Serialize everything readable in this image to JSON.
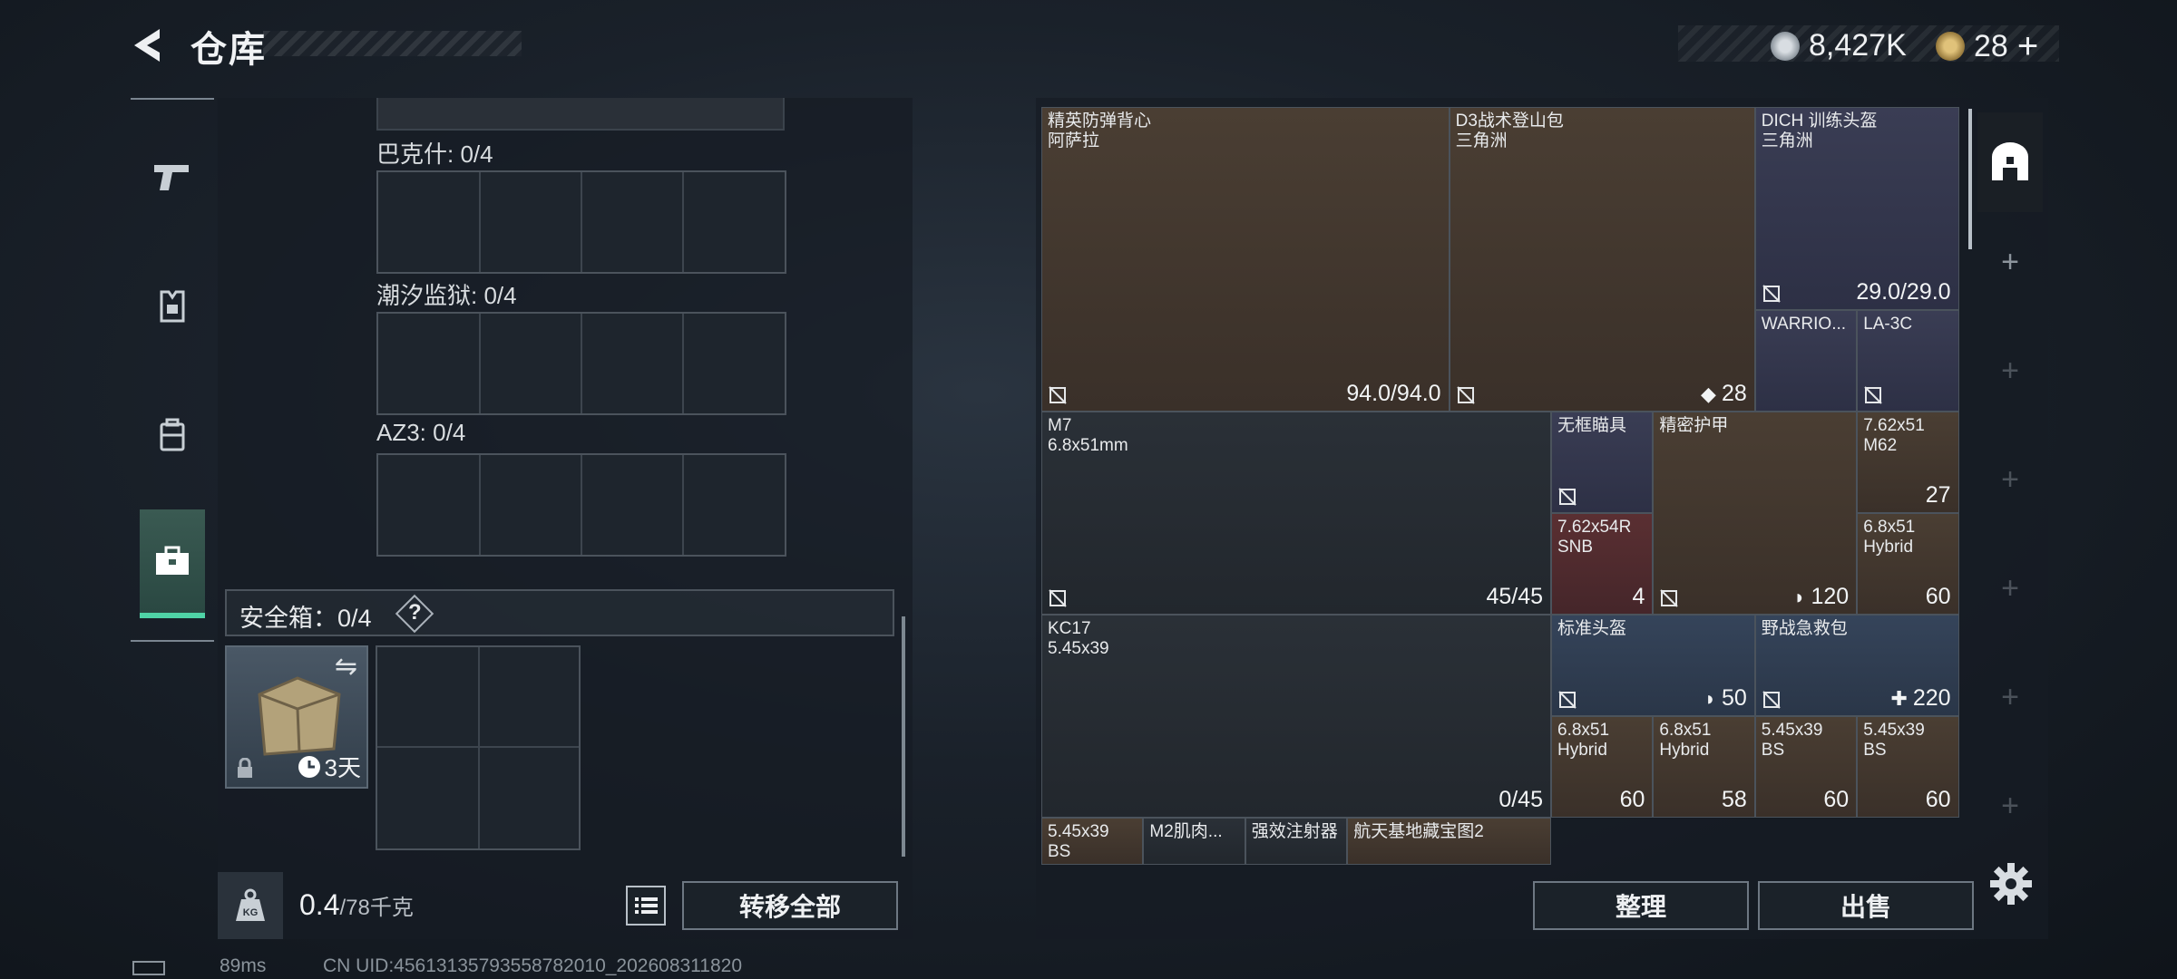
{
  "header": {
    "title": "仓库"
  },
  "currency": {
    "coins": "8,427K",
    "tickets": "28"
  },
  "stash": {
    "groups": [
      {
        "label": "巴克什: 0/4"
      },
      {
        "label": "潮汐监狱: 0/4"
      },
      {
        "label": "AZ3: 0/4"
      }
    ],
    "safe": {
      "label": "安全箱：0/4",
      "help": "?",
      "timer": "3天"
    }
  },
  "bottom": {
    "weight_current": "0.4",
    "weight_max": "/78千克",
    "transfer_label": "转移全部",
    "sort_label": "整理",
    "sell_label": "出售"
  },
  "inventory": [
    {
      "name": "精英防弹背心\n阿萨拉",
      "value": "94.0/94.0"
    },
    {
      "name": "D3战术登山包\n三角洲",
      "value": "28"
    },
    {
      "name": "DICH 训练头盔\n三角洲",
      "value": "29.0/29.0"
    },
    {
      "name": "WARRIO...",
      "value": ""
    },
    {
      "name": "LA-3C",
      "value": ""
    },
    {
      "name": "M7\n6.8x51mm",
      "value": "45/45"
    },
    {
      "name": "无框瞄具",
      "value": ""
    },
    {
      "name": "精密护甲",
      "value": "120"
    },
    {
      "name": "7.62x51\nM62",
      "value": "27"
    },
    {
      "name": "7.62x54R\nSNB",
      "value": "4"
    },
    {
      "name": "6.8x51\nHybrid",
      "value": "60"
    },
    {
      "name": "KC17\n5.45x39",
      "value": "0/45"
    },
    {
      "name": "标准头盔",
      "value": "50"
    },
    {
      "name": "野战急救包",
      "value": "220"
    },
    {
      "name": "6.8x51\nHybrid",
      "value": "60"
    },
    {
      "name": "6.8x51\nHybrid",
      "value": "58"
    },
    {
      "name": "5.45x39\nBS",
      "value": "60"
    },
    {
      "name": "5.45x39\nBS",
      "value": "60"
    },
    {
      "name": "5.45x39\nBS",
      "value": ""
    },
    {
      "name": "M2肌肉...",
      "value": ""
    },
    {
      "name": "强效注射器",
      "value": ""
    },
    {
      "name": "航天基地藏宝图2",
      "value": ""
    }
  ],
  "status": {
    "ping": "89ms",
    "uid": "CN UID:456131357935587820​10_202608311820"
  },
  "colors": {
    "accent": "#4fd3a6",
    "panel": "#161c24",
    "border": "#4b535c"
  }
}
